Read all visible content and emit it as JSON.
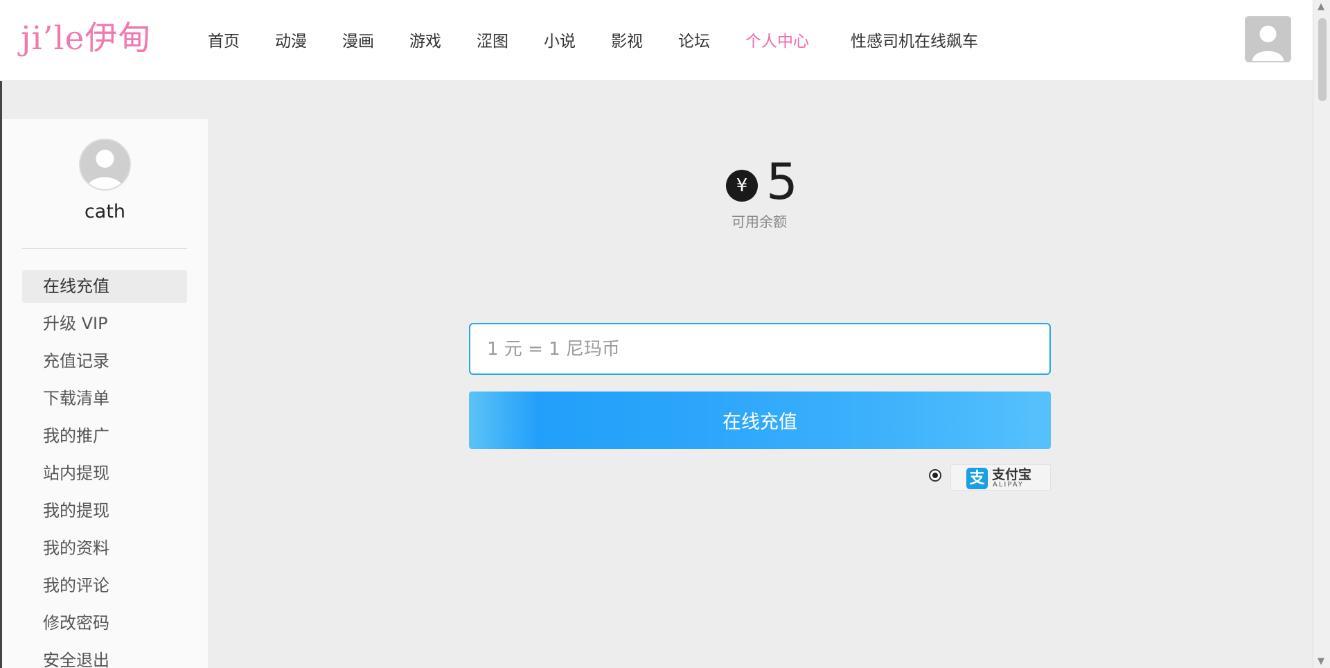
{
  "header": {
    "logo_text": "ji’le伊甸",
    "nav": [
      {
        "label": "首页"
      },
      {
        "label": "动漫"
      },
      {
        "label": "漫画"
      },
      {
        "label": "游戏"
      },
      {
        "label": "涩图"
      },
      {
        "label": "小说"
      },
      {
        "label": "影视"
      },
      {
        "label": "论坛"
      },
      {
        "label": "个人中心",
        "active": true
      },
      {
        "label": "性感司机在线飙车"
      }
    ],
    "accent_color": "#f06aa8"
  },
  "sidebar": {
    "username": "cath",
    "menu": [
      {
        "label": "在线充值",
        "active": true
      },
      {
        "label": "升级 VIP"
      },
      {
        "label": "充值记录"
      },
      {
        "label": "下载清单"
      },
      {
        "label": "我的推广"
      },
      {
        "label": "站内提现"
      },
      {
        "label": "我的提现"
      },
      {
        "label": "我的资料"
      },
      {
        "label": "我的评论"
      },
      {
        "label": "修改密码"
      },
      {
        "label": "安全退出"
      }
    ]
  },
  "main": {
    "currency_symbol": "¥",
    "balance_amount": "5",
    "balance_label": "可用余额",
    "amount_placeholder": "1 元 = 1 尼玛币",
    "recharge_button_label": "在线充值",
    "payment": {
      "selected": true,
      "icon_glyph": "支",
      "name_cn": "支付宝",
      "name_en": "ALIPAY",
      "brand_color": "#1a9fe3"
    },
    "button_color": "#229ffa"
  }
}
